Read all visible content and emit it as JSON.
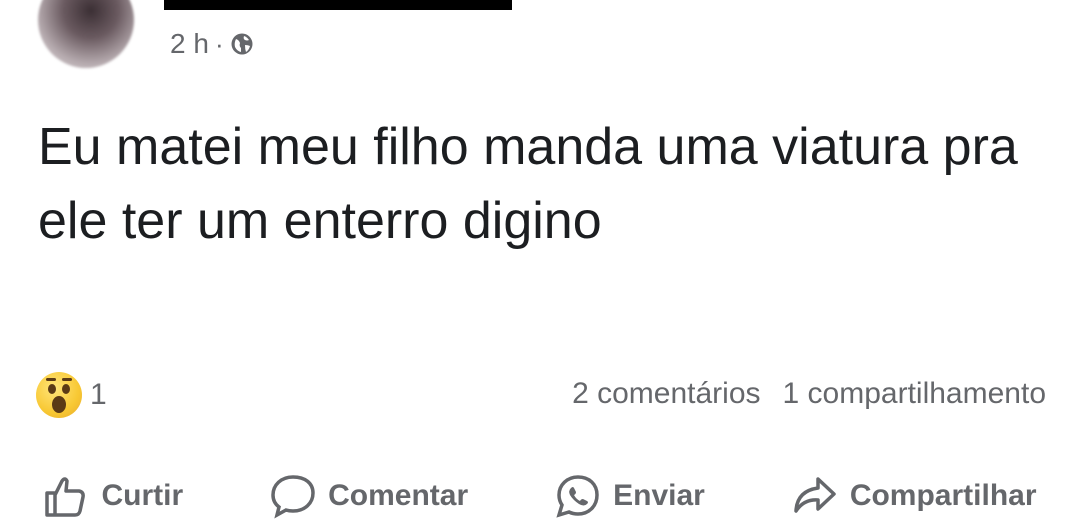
{
  "post": {
    "time": "2 h",
    "separator": "·",
    "visibility_icon": "globe-icon",
    "text": "Eu matei meu filho manda uma viatura pra ele ter um enterro digino"
  },
  "reactions": {
    "icon": "wow-reaction-icon",
    "count": "1"
  },
  "counts": {
    "comments": "2 comentários",
    "shares": "1 compartilhamento"
  },
  "actions": {
    "like": "Curtir",
    "comment": "Comentar",
    "send": "Enviar",
    "share": "Compartilhar"
  }
}
